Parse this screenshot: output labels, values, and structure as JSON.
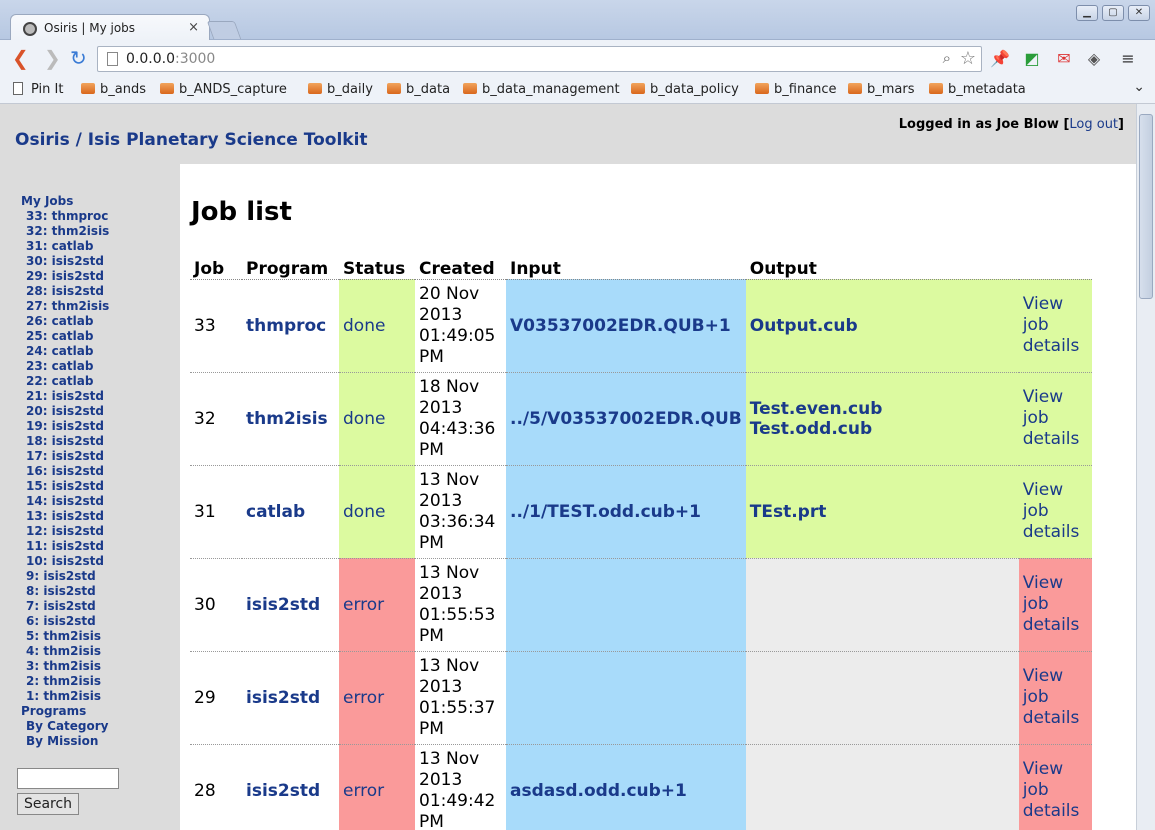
{
  "browser": {
    "tab_title": "Osiris | My jobs",
    "tab_close": "×",
    "url_host": "0.0.0.0",
    "url_port": ":3000",
    "window_buttons": [
      "▁",
      "▢",
      "✕"
    ],
    "bookmarks": [
      "Pin It",
      "b_ands",
      "b_ANDS_capture",
      "b_daily",
      "b_data",
      "b_data_management",
      "b_data_policy",
      "b_finance",
      "b_mars",
      "b_metadata"
    ]
  },
  "header": {
    "site_title": "Osiris / Isis Planetary Science Toolkit",
    "login_prefix": "Logged in as Joe Blow [",
    "logout_label": "Log out",
    "login_suffix": "]"
  },
  "sidebar": {
    "my_jobs_label": "My Jobs",
    "jobs": [
      "33: thmproc",
      "32: thm2isis",
      "31: catlab",
      "30: isis2std",
      "29: isis2std",
      "28: isis2std",
      "27: thm2isis",
      "26: catlab",
      "25: catlab",
      "24: catlab",
      "23: catlab",
      "22: catlab",
      "21: isis2std",
      "20: isis2std",
      "19: isis2std",
      "18: isis2std",
      "17: isis2std",
      "16: isis2std",
      "15: isis2std",
      "14: isis2std",
      "13: isis2std",
      "12: isis2std",
      "11: isis2std",
      "10: isis2std",
      "9: isis2std",
      "8: isis2std",
      "7: isis2std",
      "6: isis2std",
      "5: thm2isis",
      "4: thm2isis",
      "3: thm2isis",
      "2: thm2isis",
      "1: thm2isis"
    ],
    "programs_label": "Programs",
    "by_category": "By Category",
    "by_mission": "By Mission",
    "search_value": "",
    "search_button": "Search"
  },
  "main": {
    "heading": "Job list",
    "columns": [
      "Job",
      "Program",
      "Status",
      "Created",
      "Input",
      "Output"
    ],
    "view_link": [
      "View",
      "job",
      "details"
    ],
    "rows": [
      {
        "job": "33",
        "program": "thmproc",
        "status": "done",
        "created": [
          "20 Nov",
          "2013",
          "01:49:05",
          "PM"
        ],
        "input": "V03537002EDR.QUB+1",
        "output": [
          "Output.cub"
        ]
      },
      {
        "job": "32",
        "program": "thm2isis",
        "status": "done",
        "created": [
          "18 Nov",
          "2013",
          "04:43:36",
          "PM"
        ],
        "input": "../5/V03537002EDR.QUB",
        "output": [
          "Test.even.cub",
          "Test.odd.cub"
        ]
      },
      {
        "job": "31",
        "program": "catlab",
        "status": "done",
        "created": [
          "13 Nov",
          "2013",
          "03:36:34",
          "PM"
        ],
        "input": "../1/TEST.odd.cub+1",
        "output": [
          "TEst.prt"
        ]
      },
      {
        "job": "30",
        "program": "isis2std",
        "status": "error",
        "created": [
          "13 Nov",
          "2013",
          "01:55:53",
          "PM"
        ],
        "input": "",
        "output": []
      },
      {
        "job": "29",
        "program": "isis2std",
        "status": "error",
        "created": [
          "13 Nov",
          "2013",
          "01:55:37",
          "PM"
        ],
        "input": "",
        "output": []
      },
      {
        "job": "28",
        "program": "isis2std",
        "status": "error",
        "created": [
          "13 Nov",
          "2013",
          "01:49:42",
          "PM"
        ],
        "input": "asdasd.odd.cub+1",
        "output": []
      }
    ]
  },
  "colors": {
    "done": "#dcfaa0",
    "error": "#fa9a9a",
    "input": "#a8dbfa",
    "link": "#1a3a8a"
  }
}
